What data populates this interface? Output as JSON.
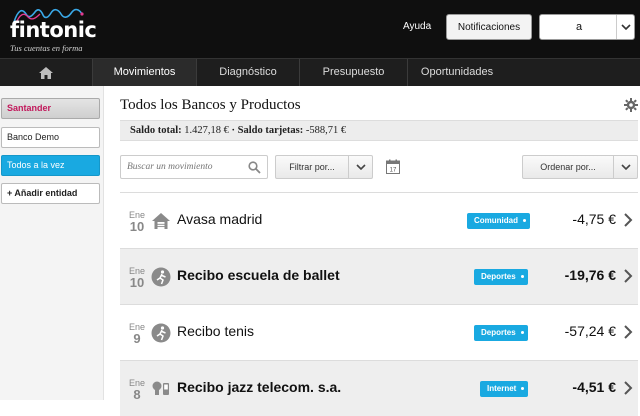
{
  "header": {
    "logo_text": "fintonic",
    "logo_tagline": "Tus cuentas en forma",
    "help_label": "Ayuda",
    "notifications_label": "Notificaciones",
    "user_value": "a"
  },
  "nav": {
    "items": [
      {
        "label": "Movimientos"
      },
      {
        "label": "Diagnóstico"
      },
      {
        "label": "Presupuesto"
      },
      {
        "label": "Oportunidades"
      }
    ]
  },
  "sidebar": {
    "items": [
      {
        "label": "Santander"
      },
      {
        "label": "Banco Demo"
      },
      {
        "label": "Todos a la vez"
      },
      {
        "label": "+ Añadir entidad"
      }
    ]
  },
  "main": {
    "title": "Todos los Bancos y Productos",
    "balance_label": "Saldo total:",
    "balance_value": "1.427,18 €",
    "cards_label": "· Saldo tarjetas:",
    "cards_value": "-588,71 €",
    "search_placeholder": "Buscar un movimiento",
    "filter_label": "Filtrar por...",
    "sort_label": "Ordenar por...",
    "calendar_day": "17"
  },
  "transactions": [
    {
      "month": "Ene",
      "day": "10",
      "name": "Avasa madrid",
      "category": "Comunidad",
      "amount": "-4,75 €",
      "icon": "house-icon"
    },
    {
      "month": "Ene",
      "day": "10",
      "name": "Recibo escuela de ballet",
      "category": "Deportes",
      "amount": "-19,76 €",
      "icon": "sports-icon"
    },
    {
      "month": "Ene",
      "day": "9",
      "name": "Recibo tenis",
      "category": "Deportes",
      "amount": "-57,24 €",
      "icon": "sports-icon"
    },
    {
      "month": "Ene",
      "day": "8",
      "name": "Recibo jazz telecom. s.a.",
      "category": "Internet",
      "amount": "-4,51 €",
      "icon": "utilities-icon"
    }
  ],
  "colors": {
    "accent": "#19a9e1",
    "header_bg": "#0f0f0f",
    "santander": "#c2185b"
  }
}
